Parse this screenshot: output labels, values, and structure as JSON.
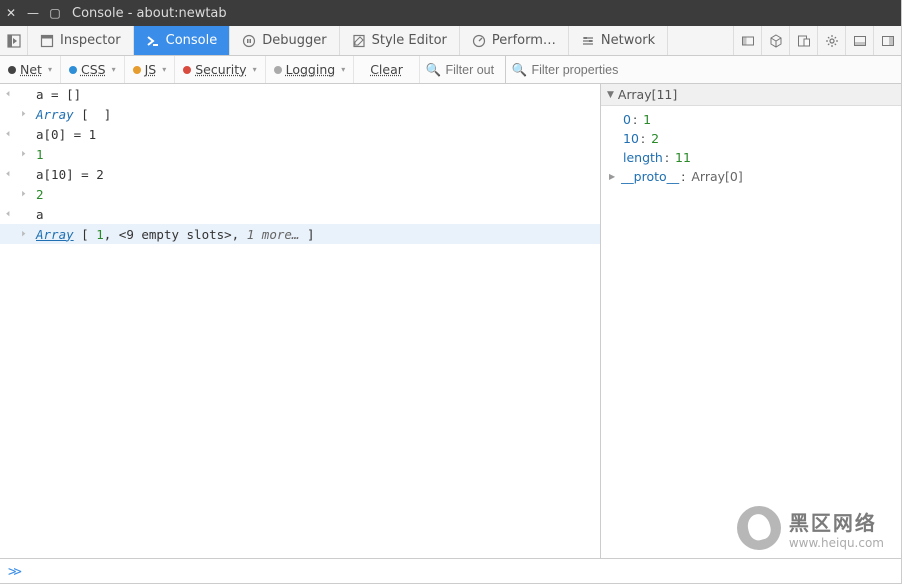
{
  "window": {
    "title": "Console - about:newtab"
  },
  "tabs": {
    "inspector": "Inspector",
    "console": "Console",
    "debugger": "Debugger",
    "styleeditor": "Style Editor",
    "performance": "Perform…",
    "network": "Network"
  },
  "filters": {
    "net": "Net",
    "css": "CSS",
    "js": "JS",
    "security": "Security",
    "logging": "Logging",
    "clear": "Clear",
    "search_output_ph": "Filter out",
    "search_props_ph": "Filter properties"
  },
  "console_lines": {
    "l0": "a = []",
    "l1_kw": "Array",
    "l1_rest": " [  ]",
    "l2": "a[0] = 1",
    "l3": "1",
    "l4": "a[10] = 2",
    "l5": "2",
    "l6": "a",
    "l7_link": "Array",
    "l7_open": " [ ",
    "l7_n1": "1",
    "l7_mid": ", <9 empty slots>, ",
    "l7_more": "1 more…",
    "l7_close": " ]"
  },
  "inspector": {
    "header": "Array[11]",
    "rows": {
      "k0": "0",
      "v0": "1",
      "k1": "10",
      "v1": "2",
      "k2": "length",
      "v2": "11",
      "k3": "__proto__",
      "v3": "Array[0]"
    }
  },
  "watermark": {
    "cn": "黑区网络",
    "url": "www.heiqu.com"
  }
}
